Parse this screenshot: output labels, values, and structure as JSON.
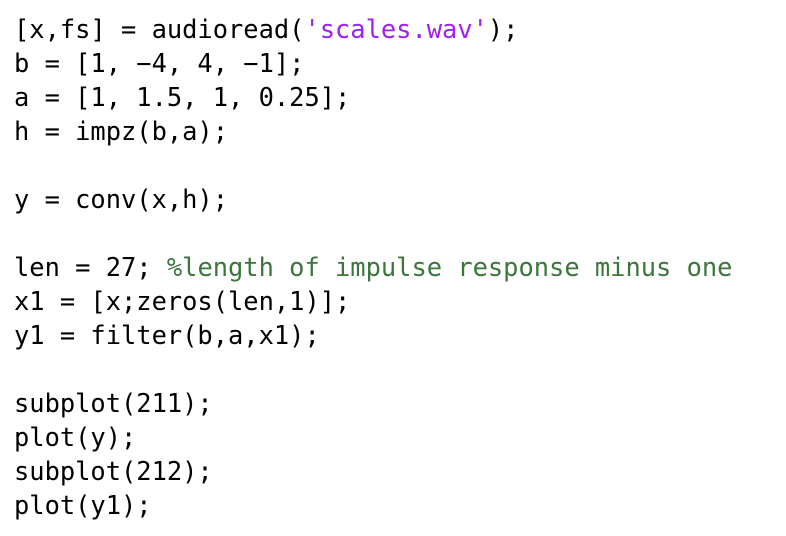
{
  "editor": {
    "colors": {
      "code": "#000000",
      "string": "#a020f0",
      "comment": "#3c763d",
      "background": "#ffffff"
    },
    "lines": [
      {
        "code": "[x,fs] = audioread(",
        "string": "'scales.wav'",
        "tail": ");"
      },
      {
        "code": "b = [1, −4, 4, −1];"
      },
      {
        "code": "a = [1, 1.5, 1, 0.25];"
      },
      {
        "code": "h = impz(b,a);"
      },
      {
        "code": ""
      },
      {
        "code": "y = conv(x,h);"
      },
      {
        "code": ""
      },
      {
        "code": "len = 27; ",
        "comment": "%length of impulse response minus one"
      },
      {
        "code": "x1 = [x;zeros(len,1)];"
      },
      {
        "code": "y1 = filter(b,a,x1);"
      },
      {
        "code": ""
      },
      {
        "code": "subplot(211);"
      },
      {
        "code": "plot(y);"
      },
      {
        "code": "subplot(212);"
      },
      {
        "code": "plot(y1);"
      }
    ]
  }
}
